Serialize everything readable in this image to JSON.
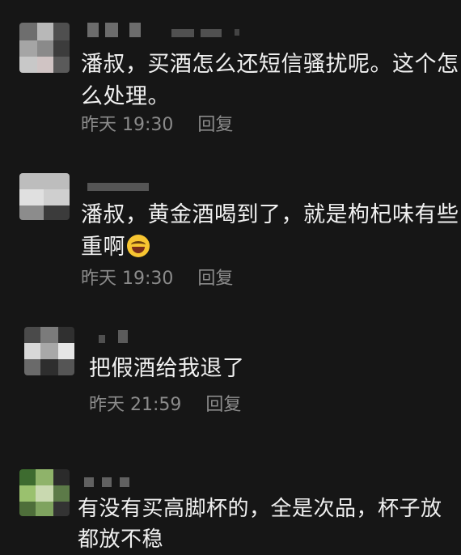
{
  "comments": [
    {
      "text_lines": [
        "潘叔，买酒怎么还短信骚扰呢。这个怎",
        "么处理。"
      ],
      "time": "昨天 19:30",
      "reply": "回复"
    },
    {
      "text_lines": [
        "潘叔，黄金酒喝到了，就是枸杞味有些",
        "重啊"
      ],
      "emoji": "laughing-crying-emoji",
      "time": "昨天 19:30",
      "reply": "回复"
    },
    {
      "text_lines": [
        "把假酒给我退了"
      ],
      "time": "昨天 21:59",
      "reply": "回复"
    },
    {
      "text_lines": [
        "有没有买高脚杯的，全是次品，杯子放",
        "都放不稳"
      ]
    }
  ],
  "colors": {
    "background": "#161616",
    "text": "#f0f0f0",
    "meta": "#8b8b8b"
  }
}
